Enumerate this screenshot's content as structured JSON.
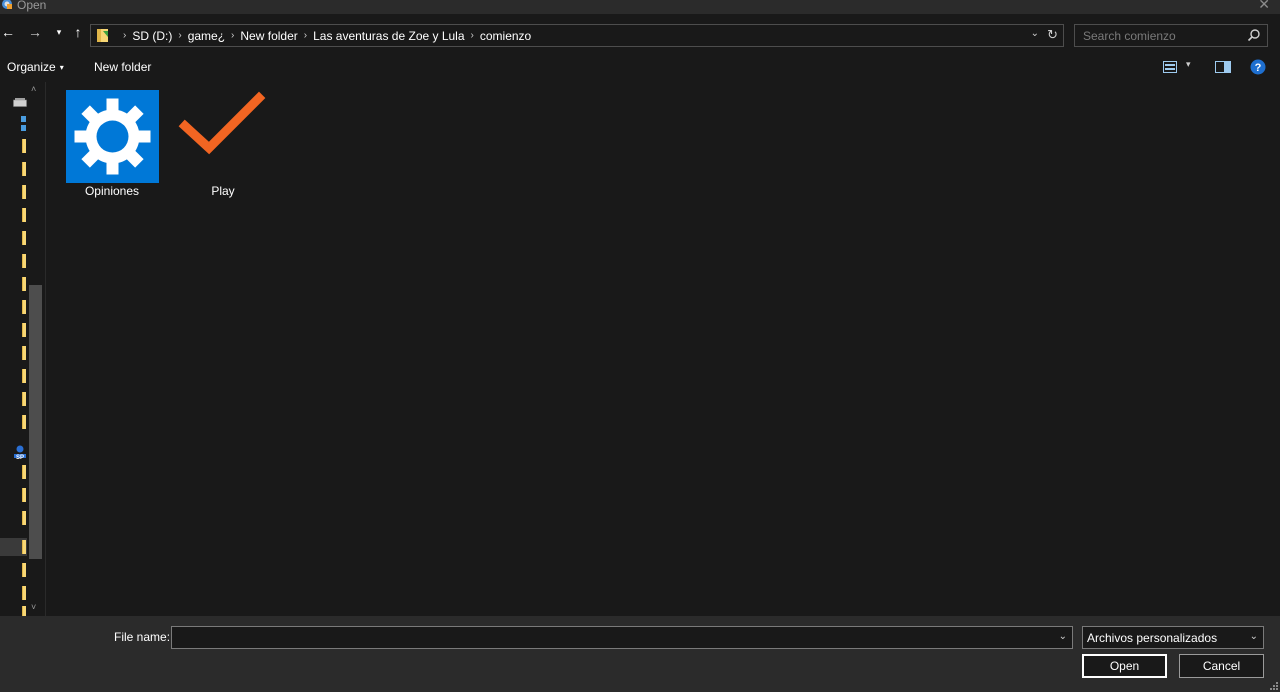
{
  "window": {
    "title": "Open",
    "close_symbol": "✕"
  },
  "nav": {
    "back_symbol": "←",
    "forward_symbol": "→",
    "recent_symbol": "▾",
    "up_symbol": "↑"
  },
  "address": {
    "crumbs": [
      "SD (D:)",
      "game¿",
      "New folder",
      "Las aventuras de Zoe y Lula",
      "comienzo"
    ],
    "separator": "›",
    "dropdown_symbol": "⌄",
    "refresh_symbol": "↻"
  },
  "search": {
    "placeholder": "Search comienzo",
    "value": ""
  },
  "toolbar": {
    "organize_label": "Organize",
    "organize_caret": "▾",
    "new_folder_label": "New folder",
    "view_dropdown_symbol": "▾"
  },
  "navpane": {
    "scroll_up": "˄",
    "scroll_down": "˅"
  },
  "files": [
    {
      "name": "Opiniones",
      "icon": "gear-icon",
      "color": "#0078d7"
    },
    {
      "name": "Play",
      "icon": "checkmark-icon",
      "color": "#f26522"
    }
  ],
  "bottom": {
    "file_name_label": "File name:",
    "file_name_value": "",
    "file_name_dropdown": "⌄",
    "file_type_value": "Archivos personalizados",
    "file_type_dropdown": "⌄",
    "open_label": "Open",
    "cancel_label": "Cancel"
  },
  "colors": {
    "background": "#191919",
    "panel": "#2b2b2b",
    "accent": "#0078d7",
    "folder": "#f8d775",
    "check": "#f26522"
  }
}
